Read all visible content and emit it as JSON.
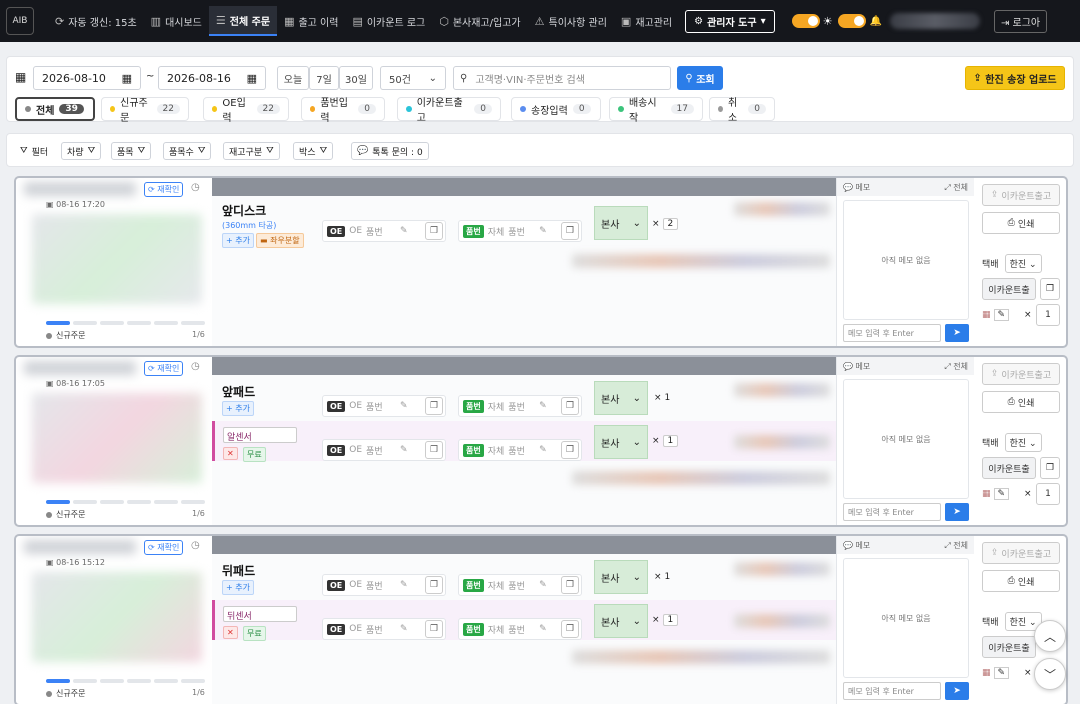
{
  "nav": {
    "logo": "AIB",
    "items": [
      {
        "label": "자동 갱신: 15초",
        "icon": "refresh-icon"
      },
      {
        "label": "대시보드",
        "icon": "chart-icon"
      },
      {
        "label": "전체 주문",
        "icon": "list-icon",
        "active": true
      },
      {
        "label": "출고 이력",
        "icon": "calendar-icon"
      },
      {
        "label": "이카운트 로그",
        "icon": "document-icon"
      },
      {
        "label": "본사재고/입고가",
        "icon": "box-icon"
      },
      {
        "label": "특이사항 관리",
        "icon": "warning-icon"
      },
      {
        "label": "재고관리",
        "icon": "inventory-icon"
      }
    ],
    "admin_label": "관리자 도구",
    "logout_label": "로그아"
  },
  "filters": {
    "date_from": "2026-08-10",
    "date_sep": "~",
    "date_to": "2026-08-16",
    "quick": [
      "오늘",
      "7일",
      "30일"
    ],
    "page_size": "50건",
    "search_placeholder": "고객명·VIN·주문번호 검색",
    "search_button": "조회",
    "upload_button": "한진 송장 업로드"
  },
  "status_tabs": [
    {
      "label": "전체",
      "count": "39",
      "color": "#888888"
    },
    {
      "label": "신규주문",
      "count": "22",
      "color": "#f5c518"
    },
    {
      "label": "OE입력",
      "count": "22",
      "color": "#f5c518"
    },
    {
      "label": "품번입력",
      "count": "0",
      "color": "#f5a623"
    },
    {
      "label": "이카운트출고",
      "count": "0",
      "color": "#2bc4d9"
    },
    {
      "label": "송장입력",
      "count": "0",
      "color": "#5b8def"
    },
    {
      "label": "배송시작",
      "count": "17",
      "color": "#3cc47c"
    },
    {
      "label": "취소",
      "count": "0",
      "color": "#999999"
    }
  ],
  "subfilters": {
    "filter_label": "필터",
    "chips": [
      "차량",
      "품목",
      "품목수",
      "재고구분",
      "박스"
    ],
    "talk_label": "톡톡 문의 : 0"
  },
  "common": {
    "confirm": "재확인",
    "status": "신규주문",
    "page": "1/6",
    "add": "+ 추가",
    "oe": "OE",
    "oe_ph": "품번",
    "partno": "품번",
    "self": "자체",
    "source": "본사",
    "x": "×",
    "free": "무료",
    "memo": "메모",
    "memo_all": "전체",
    "memo_empty": "아직 메모 없음",
    "memo_input": "메모 입력 후 Enter",
    "ecount_out": "이카운트출고",
    "print": "인쇄",
    "courier": "택배",
    "carrier": "한진",
    "ecount_copy": "이카운트출",
    "box_qty": "1"
  },
  "orders": [
    {
      "time": "08-16 17:20",
      "part": "앞디스크",
      "spec": "(360mm 타공)",
      "tag2": "좌우분할",
      "qty": "2",
      "sub": null
    },
    {
      "time": "08-16 17:05",
      "part": "앞패드",
      "spec": "",
      "tag2": "",
      "qty": "1",
      "sub": {
        "name": "알센서",
        "qty": "1"
      }
    },
    {
      "time": "08-16 15:12",
      "part": "뒤패드",
      "spec": "",
      "tag2": "",
      "qty": "1",
      "sub": {
        "name": "뒤센서",
        "qty": "1"
      }
    }
  ]
}
